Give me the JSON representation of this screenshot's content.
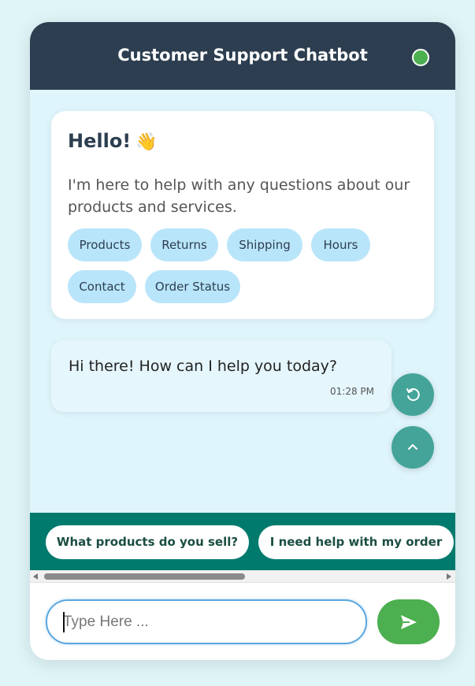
{
  "header": {
    "title": "Customer Support Chatbot",
    "status": "online"
  },
  "welcome": {
    "title": "Hello!",
    "emoji": "👋",
    "text": "I'm here to help with any questions about our products and services.",
    "chips": [
      "Products",
      "Returns",
      "Shipping",
      "Hours",
      "Contact",
      "Order Status"
    ]
  },
  "message": {
    "text": "Hi there! How can I help you today?",
    "time": "01:28 PM"
  },
  "actions": {
    "refresh_icon": "refresh-icon",
    "scroll_top_icon": "chevron-up-icon"
  },
  "quick_replies": [
    "What products do you sell?",
    "I need help with my order"
  ],
  "input": {
    "placeholder": "Type Here ...",
    "value": ""
  },
  "send": {
    "icon": "send-icon"
  },
  "colors": {
    "header": "#2c3e50",
    "accent": "#4caf50",
    "quick_bar": "#017a6e",
    "fab": "#45a49a",
    "chip": "#b9e5fa"
  }
}
